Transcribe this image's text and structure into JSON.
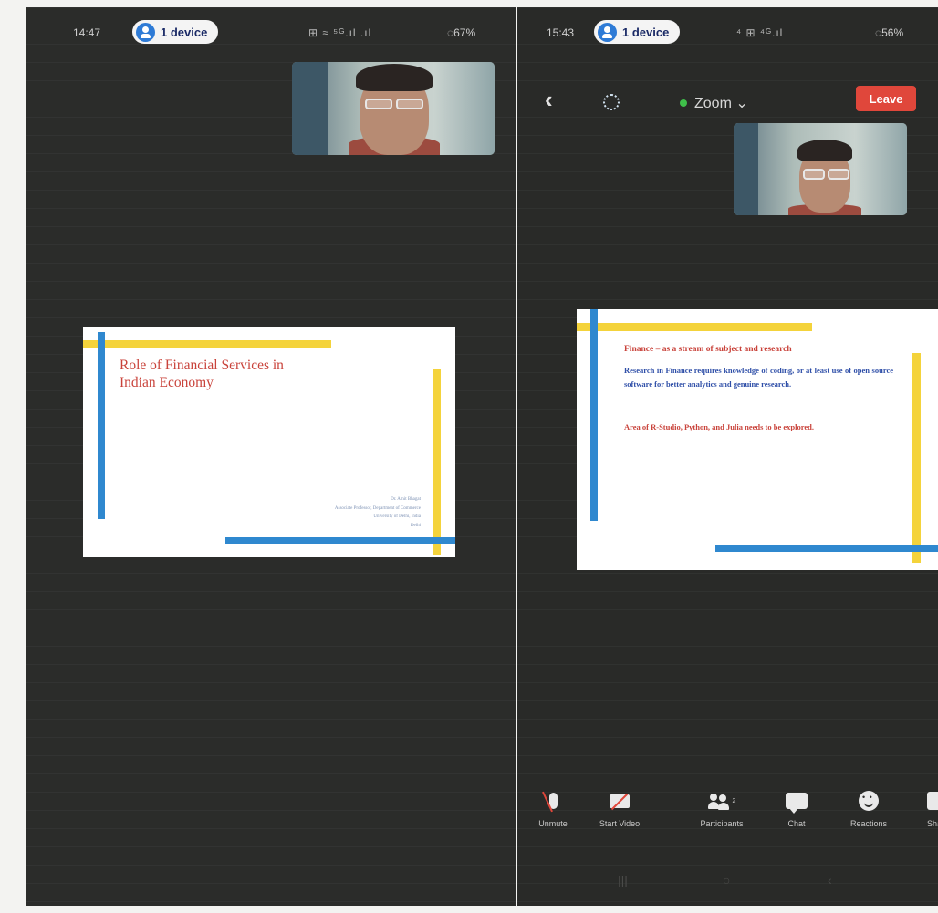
{
  "left_screen": {
    "status": {
      "time": "14:47",
      "device_pill": "1 device",
      "icons": "⊞ ≈ ⁵ᴳ.ıl .ıl",
      "battery": "◌67%"
    },
    "slide": {
      "title_line1": "Role of Financial Services in",
      "title_line2": "Indian Economy",
      "author_lines": [
        "Dr. Amit Bhagat",
        "Associate Professor, Department of Commerce",
        "University of Delhi, India",
        "Delhi"
      ]
    }
  },
  "right_screen": {
    "status": {
      "time": "15:43",
      "device_pill": "1 device",
      "icons": "⁴ ⊞ ⁴ᴳ.ıl",
      "battery": "◌56%"
    },
    "nav": {
      "back": "‹",
      "meeting_title": "Zoom",
      "leave": "Leave"
    },
    "slide": {
      "heading": "Finance – as a stream of subject and research",
      "paragraph1": "Research in Finance requires knowledge of coding, or at least use of open source software for better analytics and genuine research.",
      "paragraph2": "Area of R-Studio, Python, and Julia needs to be explored."
    },
    "toolbar": [
      "Unmute",
      "Start Video",
      "Participants",
      "Chat",
      "Reactions",
      "Share"
    ],
    "participants_count": "2"
  },
  "colors": {
    "background": "#2b2c2a",
    "slide_red": "#c9433b",
    "slide_blue": "#2f88cf",
    "slide_yellow": "#f4d33b",
    "leave_red": "#e0473b",
    "pill_blue": "#2e7bd6"
  }
}
